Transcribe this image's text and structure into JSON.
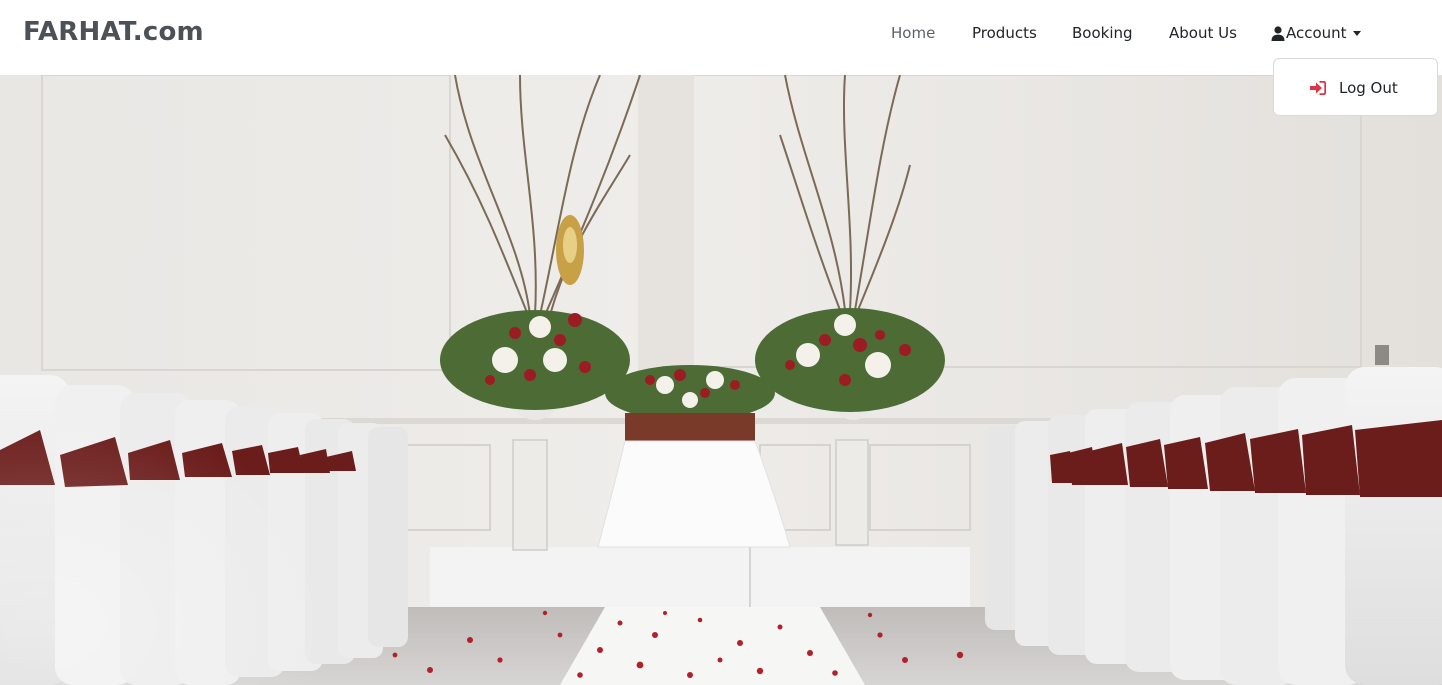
{
  "navbar": {
    "brand": "FARHAT.com",
    "links": {
      "home": "Home",
      "products": "Products",
      "booking": "Booking",
      "about": "About Us",
      "account": "Account"
    },
    "account_icon": "user-icon",
    "active_link_color": "#5c636a"
  },
  "account_menu": {
    "items": [
      {
        "label": "Log Out",
        "icon": "sign-in-arrow-icon",
        "icon_color": "#dc3545"
      }
    ]
  },
  "hero": {
    "image_subject": "wedding ceremony aisle with white chair covers, floral arrangements and rose petals"
  }
}
